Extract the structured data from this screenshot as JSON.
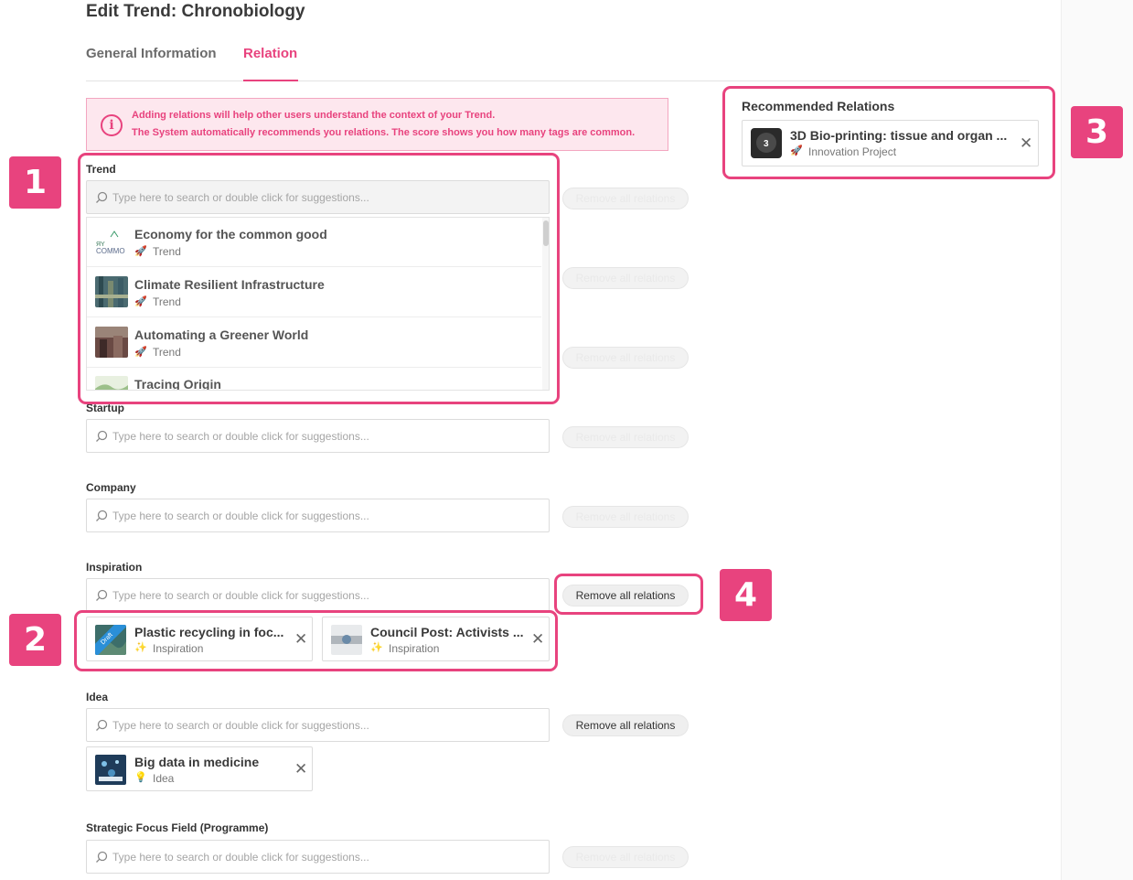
{
  "page": {
    "title": "Edit Trend: Chronobiology"
  },
  "tabs": [
    {
      "label": "General Information",
      "active": false
    },
    {
      "label": "Relation",
      "active": true
    }
  ],
  "info": {
    "line1": "Adding relations will help other users understand the context of your Trend.",
    "line2": "The System automatically recommends you relations. The score shows you how many tags are common."
  },
  "search_placeholder": "Type here to search or double click for suggestions...",
  "remove_all_label": "Remove all relations",
  "sections": {
    "trend": {
      "label": "Trend"
    },
    "startup": {
      "label": "Startup"
    },
    "company": {
      "label": "Company"
    },
    "inspiration": {
      "label": "Inspiration"
    },
    "idea": {
      "label": "Idea"
    },
    "strategic": {
      "label": "Strategic Focus Field (Programme)"
    }
  },
  "dropdown": {
    "items": [
      {
        "title": "Economy for the common good",
        "type": "Trend"
      },
      {
        "title": "Climate Resilient Infrastructure",
        "type": "Trend"
      },
      {
        "title": "Automating a Greener World",
        "type": "Trend"
      },
      {
        "title": "Tracing Origin",
        "type": ""
      }
    ]
  },
  "inspiration_cards": [
    {
      "title": "Plastic recycling in foc...",
      "type": "Inspiration",
      "draft": "Draft"
    },
    {
      "title": "Council Post: Activists ...",
      "type": "Inspiration"
    }
  ],
  "idea_cards": [
    {
      "title": "Big data in medicine",
      "type": "Idea"
    }
  ],
  "recommended": {
    "title": "Recommended Relations",
    "items": [
      {
        "title": "3D Bio-printing: tissue and organ ...",
        "type": "Innovation Project",
        "score": "3"
      }
    ]
  },
  "badges": {
    "b1": "1",
    "b2": "2",
    "b3": "3",
    "b4": "4"
  },
  "colors": {
    "accent": "#e8437e",
    "info_bg": "#fde7ee",
    "draft": "#2a8fd8"
  },
  "icons": {
    "type_trend": "rocket-icon",
    "type_inspiration": "sparkle-icon",
    "type_idea": "lightbulb-icon",
    "close": "close-icon",
    "search": "search-icon",
    "info": "info-icon"
  }
}
